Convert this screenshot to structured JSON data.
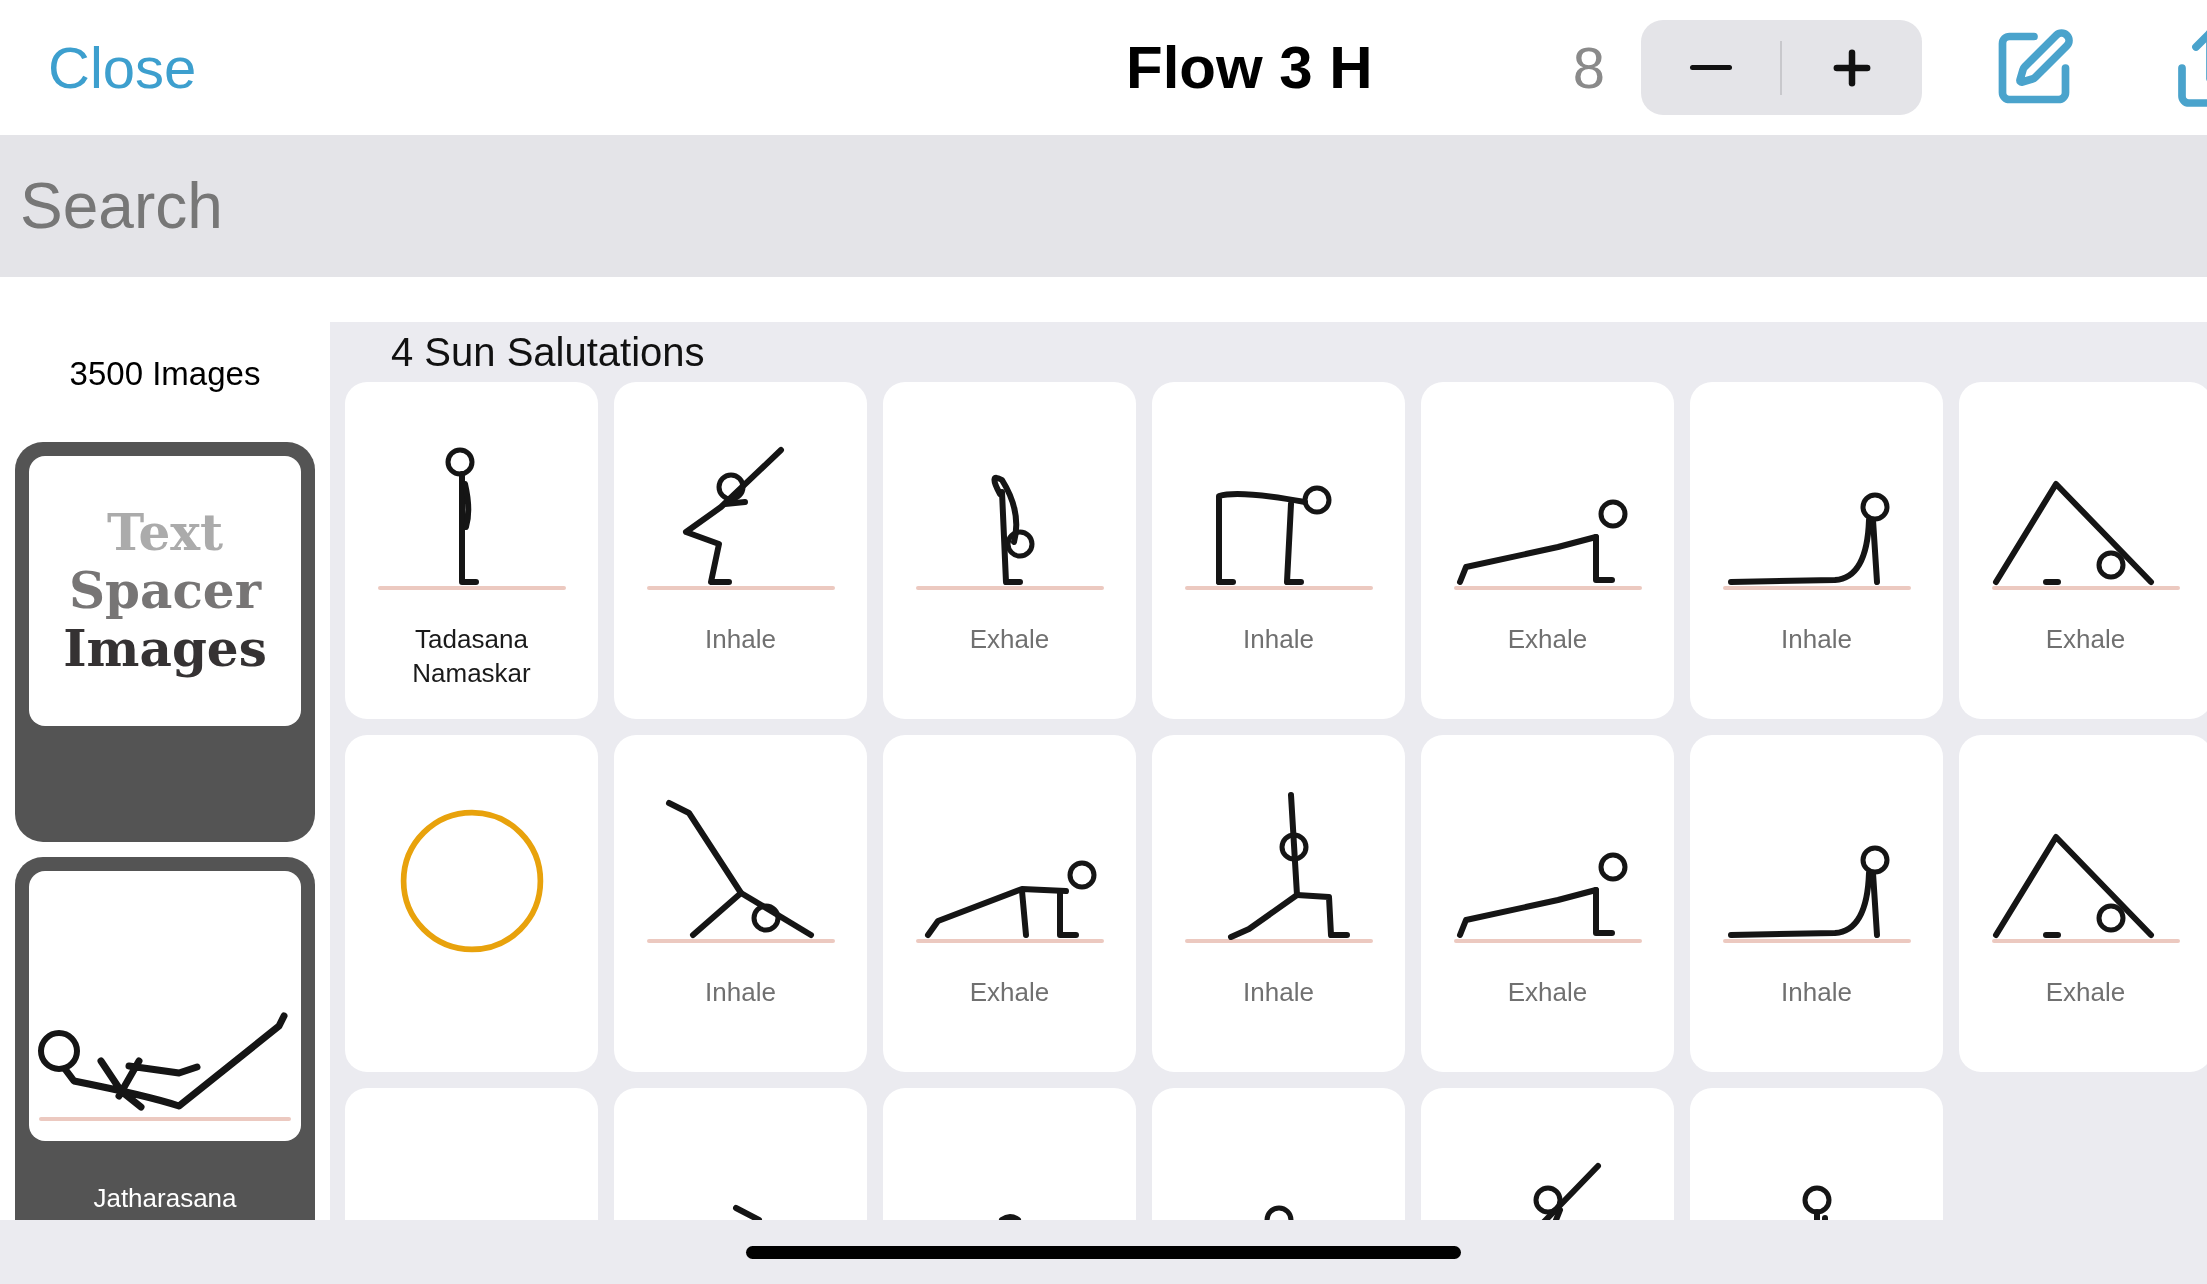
{
  "top_bar": {
    "close": "Close",
    "title": "Flow 3 H",
    "count": "8"
  },
  "search": {
    "placeholder": "Search"
  },
  "sidebar": {
    "count": "3500 Images",
    "cards": [
      {
        "kind": "text_spacer",
        "lines": [
          "Text",
          "Spacer",
          "Images"
        ]
      },
      {
        "kind": "pose",
        "label": "Jatharasana"
      }
    ]
  },
  "section": {
    "title": "4 Sun Salutations",
    "tiles": [
      {
        "kind": "pose",
        "label": "Tadasana Namaskar"
      },
      {
        "kind": "pose",
        "label": "Inhale"
      },
      {
        "kind": "pose",
        "label": "Exhale"
      },
      {
        "kind": "pose",
        "label": "Inhale"
      },
      {
        "kind": "pose",
        "label": "Exhale"
      },
      {
        "kind": "pose",
        "label": "Inhale"
      },
      {
        "kind": "pose",
        "label": "Exhale"
      },
      {
        "kind": "circle"
      },
      {
        "kind": "pose",
        "label": "Inhale"
      },
      {
        "kind": "pose",
        "label": "Exhale"
      },
      {
        "kind": "pose",
        "label": "Inhale"
      },
      {
        "kind": "pose",
        "label": "Exhale"
      },
      {
        "kind": "pose",
        "label": "Inhale"
      },
      {
        "kind": "pose",
        "label": "Exhale"
      },
      {
        "kind": "pose"
      },
      {
        "kind": "pose"
      },
      {
        "kind": "pose"
      },
      {
        "kind": "pose"
      },
      {
        "kind": "pose"
      },
      {
        "kind": "pose"
      }
    ]
  }
}
